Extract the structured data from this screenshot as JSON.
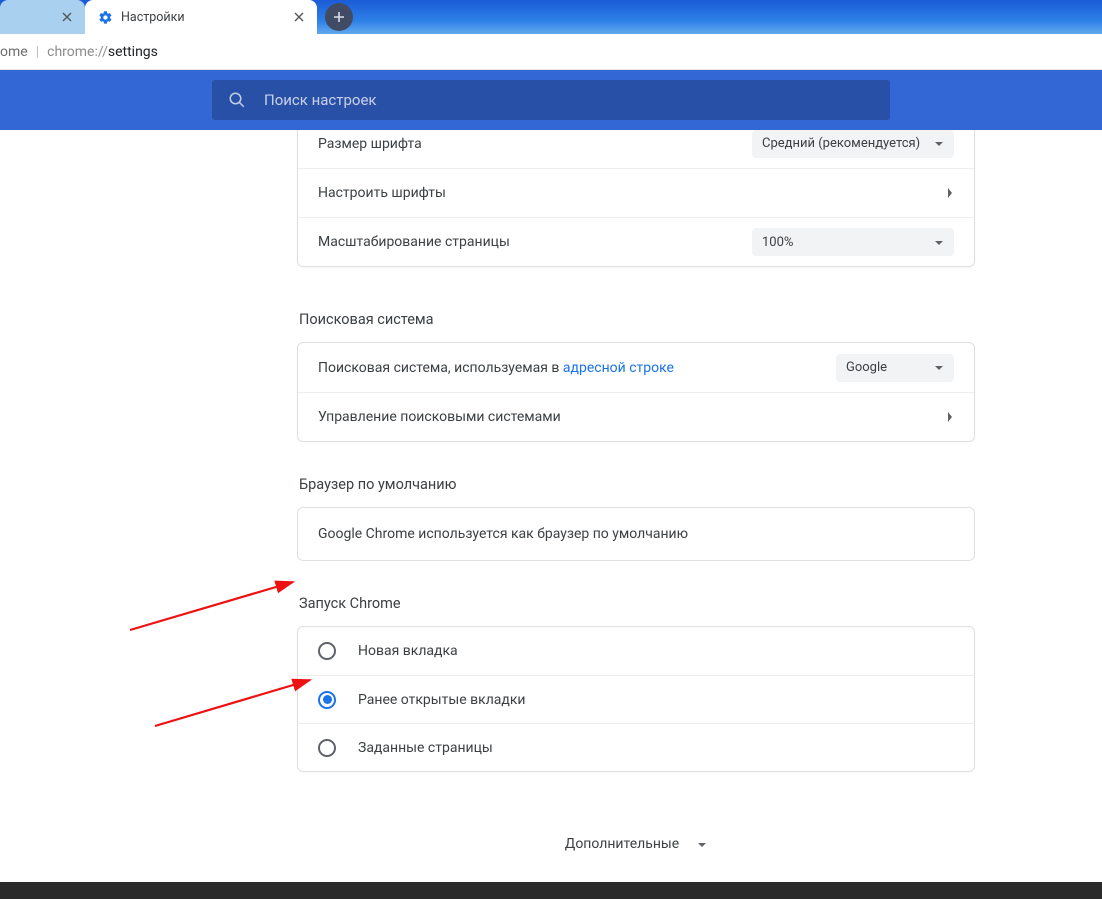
{
  "tabs": {
    "active_title": "Настройки"
  },
  "addressbar": {
    "left": "ome",
    "dim": "chrome://",
    "strong": "settings"
  },
  "search": {
    "placeholder": "Поиск настроек"
  },
  "appearance": {
    "font_size_label": "Размер шрифта",
    "font_size_value": "Средний (рекомендуется)",
    "customize_fonts_label": "Настроить шрифты",
    "zoom_label": "Масштабирование страницы",
    "zoom_value": "100%"
  },
  "search_engine": {
    "section": "Поисковая система",
    "used_in_prefix": "Поисковая система, используемая в ",
    "used_in_link": "адресной строке",
    "value": "Google",
    "manage_label": "Управление поисковыми системами"
  },
  "default_browser": {
    "section": "Браузер по умолчанию",
    "text": "Google Chrome используется как браузер по умолчанию"
  },
  "startup": {
    "section": "Запуск Chrome",
    "options": [
      {
        "label": "Новая вкладка",
        "checked": false
      },
      {
        "label": "Ранее открытые вкладки",
        "checked": true
      },
      {
        "label": "Заданные страницы",
        "checked": false
      }
    ]
  },
  "advanced": "Дополнительные"
}
